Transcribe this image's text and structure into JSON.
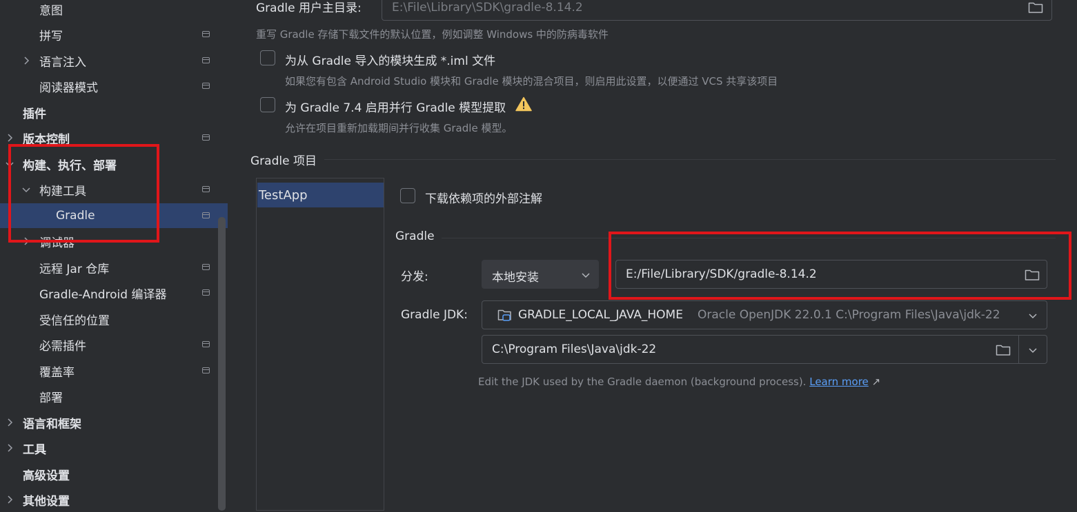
{
  "sidebar": {
    "items": [
      {
        "label": "意图"
      },
      {
        "label": "拼写"
      },
      {
        "label": "语言注入"
      },
      {
        "label": "阅读器模式"
      },
      {
        "label": "插件"
      },
      {
        "label": "版本控制"
      },
      {
        "label": "构建、执行、部署"
      },
      {
        "label": "构建工具"
      },
      {
        "label": "Gradle"
      },
      {
        "label": "调试器"
      },
      {
        "label": "远程 Jar 仓库"
      },
      {
        "label": "Gradle-Android 编译器"
      },
      {
        "label": "受信任的位置"
      },
      {
        "label": "必需插件"
      },
      {
        "label": "覆盖率"
      },
      {
        "label": "部署"
      },
      {
        "label": "语言和框架"
      },
      {
        "label": "工具"
      },
      {
        "label": "高级设置"
      },
      {
        "label": "其他设置"
      }
    ]
  },
  "main": {
    "gradle_user_home": {
      "label": "Gradle 用户主目录:",
      "value": "E:\\File\\Library\\SDK\\gradle-8.14.2",
      "hint": "重写 Gradle 存储下载文件的默认位置，例如调整 Windows 中的防病毒软件"
    },
    "iml_option": {
      "label": "为从 Gradle 导入的模块生成 *.iml 文件",
      "hint": "如果您有包含 Android Studio 模块和 Gradle 模块的混合项目，则启用此设置，以便通过 VCS 共享该项目",
      "checked": false
    },
    "parallel_option": {
      "label": "为 Gradle 7.4 启用并行 Gradle 模型提取",
      "hint": "允许在项目重新加载期间并行收集 Gradle 模型。",
      "checked": false
    },
    "projects_section": {
      "title": "Gradle 项目",
      "projects": [
        "TestApp"
      ]
    },
    "download_annotations": {
      "label": "下载依赖项的外部注解",
      "checked": false
    },
    "gradle_section": {
      "title": "Gradle",
      "distribution_label": "分发:",
      "distribution_value": "本地安装",
      "distribution_path": "E:/File/Library/SDK/gradle-8.14.2",
      "jdk_label": "Gradle JDK:",
      "jdk_name": "GRADLE_LOCAL_JAVA_HOME",
      "jdk_detail": "Oracle OpenJDK 22.0.1 C:\\Program Files\\Java\\jdk-22",
      "jdk_path": "C:\\Program Files\\Java\\jdk-22",
      "jdk_hint": "Edit the JDK used by the Gradle daemon (background process).",
      "learn_more": "Learn more",
      "learn_more_arrow": "↗"
    }
  },
  "colors": {
    "background": "#2b2d30",
    "selection": "#2e436e",
    "annotation_red": "#e0161a",
    "link": "#5a9ef7",
    "warning": "#f2c55c"
  }
}
